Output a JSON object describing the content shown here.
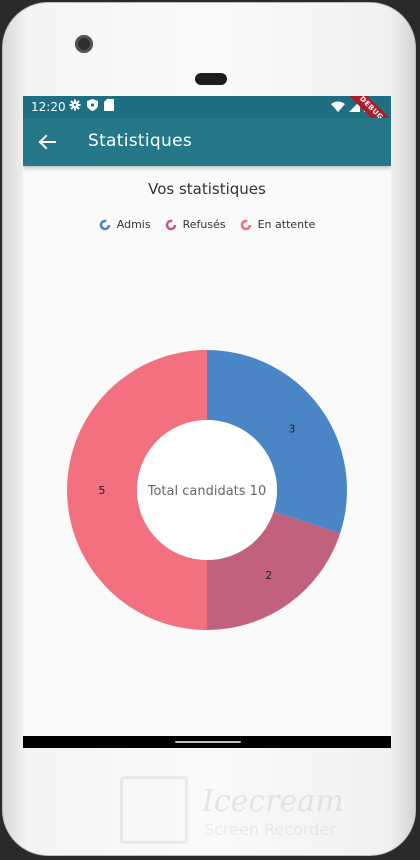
{
  "status_bar": {
    "time": "12:20",
    "debug_label": "DEBUG"
  },
  "app_bar": {
    "title": "Statistiques",
    "back_icon": "arrow-back-icon"
  },
  "content": {
    "heading": "Vos statistiques"
  },
  "legend": [
    {
      "label": "Admis",
      "color": "#4a86c5"
    },
    {
      "label": "Refusés",
      "color": "#c0627e"
    },
    {
      "label": "En attente",
      "color": "#f2707f"
    }
  ],
  "chart_data": {
    "type": "pie",
    "subtype": "donut",
    "center_label": "Total candidats 10",
    "categories": [
      "Admis",
      "Refusés",
      "En attente"
    ],
    "values": [
      3,
      2,
      5
    ],
    "labels": [
      "3",
      "2",
      "5"
    ],
    "colors": [
      "#4a86c5",
      "#c0627e",
      "#f2707f"
    ]
  },
  "watermark": {
    "text": "Icecream",
    "subtext": "Screen Recorder"
  }
}
